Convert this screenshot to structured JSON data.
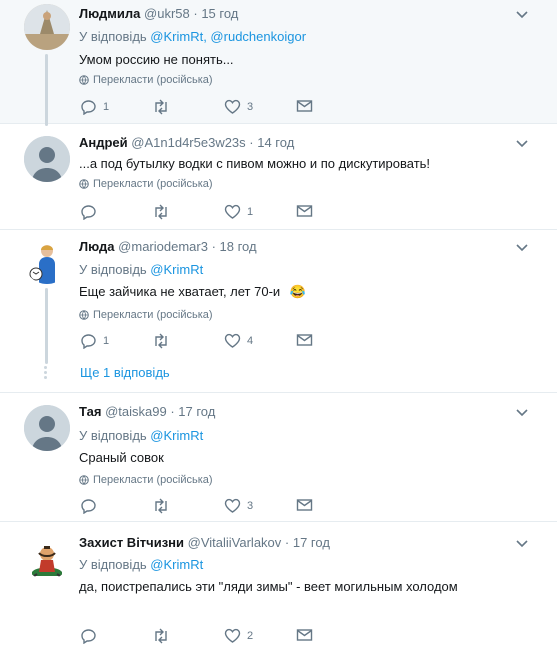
{
  "ui": {
    "translate_label": "Перекласти (російська)",
    "reply_prefix": "У відповідь ",
    "more_replies": "Ще 1 відповідь"
  },
  "tweets": [
    {
      "name": "Людмила",
      "handle": "@ukr58",
      "time": "· 15 год",
      "reply_to": "@KrimRt, @rudchenkoigor",
      "text": "Умом россию не понять...",
      "replies": "1",
      "retweets": "",
      "likes": "3"
    },
    {
      "name": "Андрей",
      "handle": "@A1n1d4r5e3w23s",
      "time": "· 14 год",
      "text": "...а под бутылку водки с пивом можно и по дискутировать!",
      "replies": "",
      "retweets": "",
      "likes": "1"
    },
    {
      "name": "Люда",
      "handle": "@mariodemar3",
      "time": "· 18 год",
      "reply_to": "@KrimRt",
      "text": "Еще зайчика не хватает, лет 70-и",
      "emoji": "😂",
      "replies": "1",
      "retweets": "",
      "likes": "4"
    },
    {
      "name": "Тая",
      "handle": "@taiska99",
      "time": "· 17 год",
      "reply_to": "@KrimRt",
      "text": "Сраный совок",
      "replies": "",
      "retweets": "",
      "likes": "3"
    },
    {
      "name": "Захист Вітчизни",
      "handle": "@VitaliiVarlakov",
      "time": "· 17 год",
      "reply_to": "@KrimRt",
      "text": "да, поистрепались эти \"ляди зимы\" - веет могильным холодом",
      "replies": "",
      "retweets": "",
      "likes": "2"
    }
  ]
}
